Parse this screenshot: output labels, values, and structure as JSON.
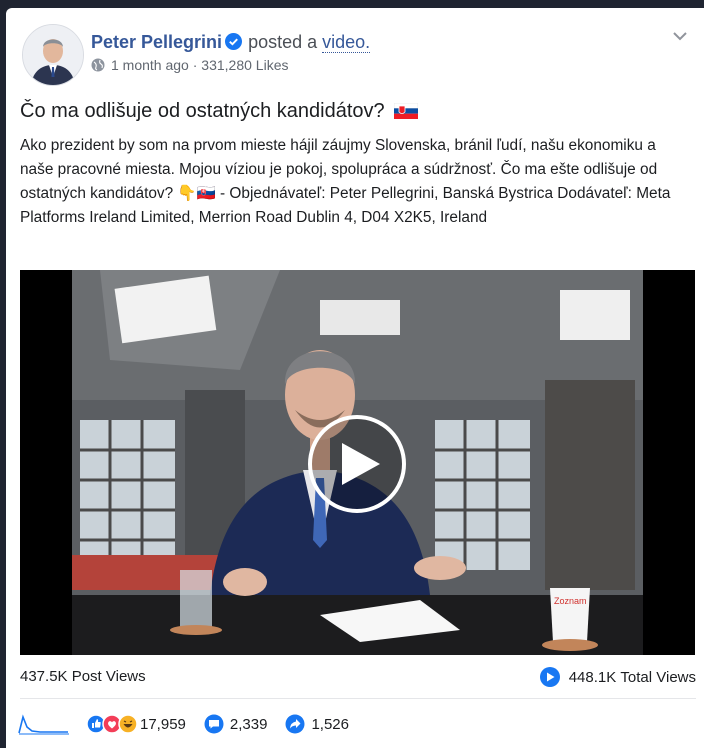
{
  "post": {
    "author": "Peter Pellegrini",
    "action": "posted a",
    "action_link": "video.",
    "time": "1 month ago",
    "separator": " · ",
    "likes": "331,280 Likes",
    "title": "Čo ma odlišuje od ostatných kandidátov?",
    "body": "Ako prezident by som na prvom mieste hájil záujmy Slovenska, bránil ľudí, našu ekonomiku a naše pracovné miesta. Mojou víziou je pokoj, spolupráca a súdržnosť. Čo ma ešte odlišuje od ostatných kandidátov? 👇🇸🇰 - Objednávateľ: Peter Pellegrini, Banská Bystrica Dodávateľ: Meta Platforms Ireland Limited, Merrion Road Dublin 4, D04 X2K5, Ireland"
  },
  "video": {
    "cup_logo": "Zoznam"
  },
  "stats": {
    "post_views": "437.5K Post Views",
    "total_views_value": "448.1K",
    "total_views_label": "Total Views",
    "reactions": "17,959",
    "comments": "2,339",
    "shares": "1,526"
  },
  "colors": {
    "link": "#365899",
    "accent": "#1877f2",
    "page_bg": "#1f2431"
  },
  "icons": [
    "verified-badge-icon",
    "globe-icon",
    "chevron-down-icon",
    "flag-icon",
    "play-icon",
    "views-icon",
    "sparkline-icon",
    "like-icon",
    "love-icon",
    "haha-icon",
    "comment-icon",
    "share-icon"
  ]
}
